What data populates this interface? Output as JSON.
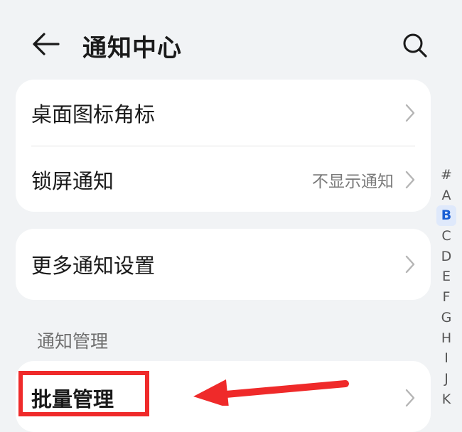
{
  "header": {
    "title": "通知中心",
    "back_icon": "back-arrow-icon",
    "search_icon": "search-icon"
  },
  "card_main": {
    "items": [
      {
        "label": "桌面图标角标",
        "value": ""
      },
      {
        "label": "锁屏通知",
        "value": "不显示通知"
      }
    ]
  },
  "card_more": {
    "items": [
      {
        "label": "更多通知设置",
        "value": ""
      }
    ]
  },
  "section": {
    "title": "通知管理"
  },
  "card_manage": {
    "items": [
      {
        "label": "批量管理",
        "value": ""
      }
    ]
  },
  "alpha_index": {
    "letters": [
      "#",
      "A",
      "B",
      "C",
      "D",
      "E",
      "F",
      "G",
      "H",
      "I",
      "J",
      "K"
    ],
    "active": "B"
  },
  "annotation": {
    "color": "#ef2a2a"
  },
  "colors": {
    "background": "#f1f3f5",
    "card": "#ffffff",
    "accent": "#1a5fd4",
    "secondary_text": "#7a7a7a"
  }
}
